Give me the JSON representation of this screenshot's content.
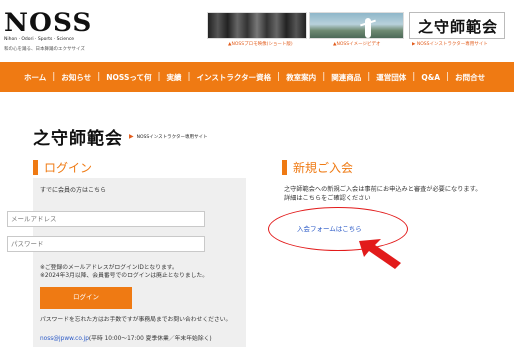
{
  "header": {
    "logo_text": "NOSS",
    "logo_tagline": "Nihon · Odori · Sports · Science",
    "logo_sub": "和の心を踊る、日本舞踊のエクササイズ",
    "banners": [
      {
        "caption": "▲NOSSプロモ映像(ショート版)"
      },
      {
        "caption": "▲NOSSイメージビデオ"
      },
      {
        "title": "之守師範会",
        "caption": "▶ NOSSインストラクター専用サイト"
      }
    ]
  },
  "nav": {
    "items": [
      "ホーム",
      "お知らせ",
      "NOSSって何",
      "実績",
      "インストラクター資格",
      "教室案内",
      "関連商品",
      "運営団体",
      "Q&A",
      "お問合せ"
    ]
  },
  "brand": {
    "name": "之守師範会",
    "arrow": "▶",
    "sub": "NOSSインストラクター専用サイト"
  },
  "login": {
    "heading": "ログイン",
    "intro": "すでに会員の方はこちら",
    "email_placeholder": "メールアドレス",
    "password_placeholder": "パスワード",
    "note1": "※ご登録のメールアドレスがログインIDとなります。",
    "note2": "※2024年3月以降、会員番号でのログインは廃止となりました。",
    "button_label": "ログイン",
    "forgot_text": "パスワードを忘れた方はお手数ですが事務局までお問い合わせください。",
    "contact_email": "noss@jpww.co.jp",
    "contact_hours": "(平時 10:00～17:00 夏季休業／年末年始除く)"
  },
  "register": {
    "heading": "新規ご入会",
    "text1": "之守師範会への新規ご入会は事前にお申込みと審査が必要になります。",
    "text2": "詳細はこちらをご確認ください",
    "link_label": "入会フォームはこちら"
  },
  "colors": {
    "accent": "#ef7a13",
    "link": "#2a59c7",
    "annotation": "#e21b1b"
  }
}
